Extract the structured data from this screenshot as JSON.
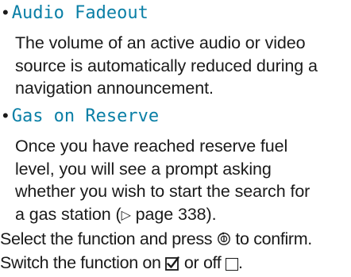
{
  "items": [
    {
      "bullet": "•",
      "heading": "Audio Fadeout",
      "body_lines": [
        "The volume of an active audio or video",
        "source is automatically reduced during a",
        "navigation announcement."
      ]
    },
    {
      "bullet": "•",
      "heading": "Gas on Reserve",
      "body_lines": [
        "Once you have reached reserve fuel",
        "level, you will see a prompt asking",
        "whether you wish to start the search for",
        "a gas station ("
      ],
      "page_ref_symbol": "▷",
      "page_ref_text": " page 338)."
    }
  ],
  "instructions": {
    "line1_before": "Select the function and press ",
    "controller_icon": "controller-icon",
    "line1_after": " to confirm.",
    "line2_before": "Switch the function on ",
    "on_icon": "checked-box-icon",
    "line2_middle": " or off ",
    "off_icon": "empty-box-icon",
    "line2_after": "."
  }
}
